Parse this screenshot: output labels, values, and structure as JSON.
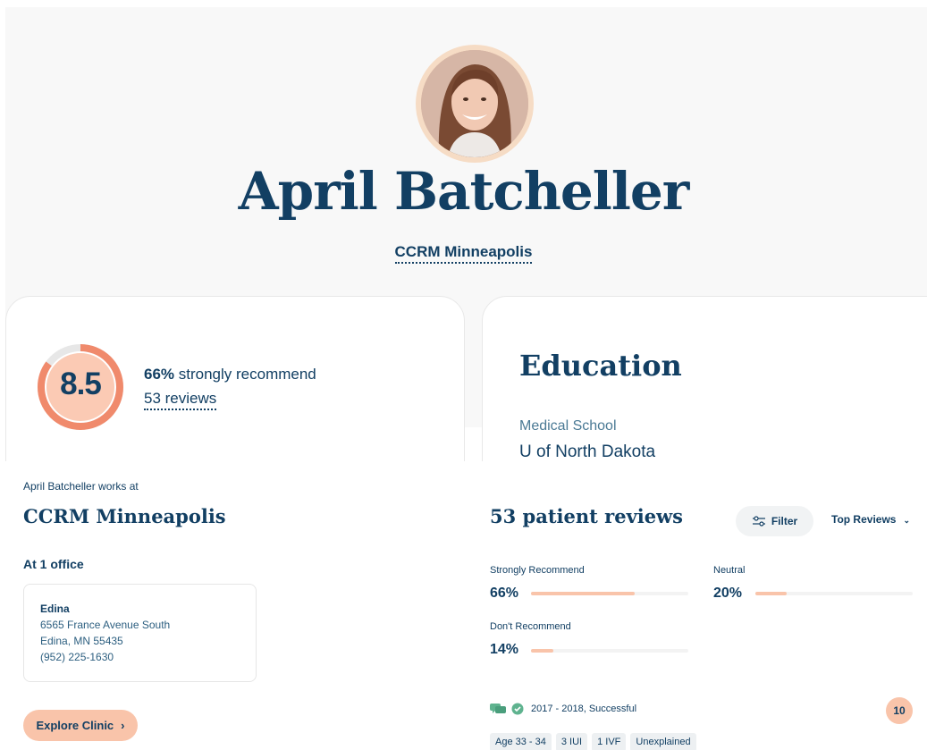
{
  "doctor": {
    "name": "April Batcheller",
    "clinic_link": "CCRM Minneapolis"
  },
  "score": {
    "value": "8.5",
    "strongly_recommend_pct": "66%",
    "strongly_recommend_text": " strongly recommend",
    "reviews_link": "53 reviews",
    "ring_color": "#f08a6c",
    "ring_fill_fraction": 0.85
  },
  "education": {
    "title": "Education",
    "label": "Medical School",
    "value": "U of North Dakota"
  },
  "works_at": {
    "intro": "April Batcheller works at",
    "clinic": "CCRM Minneapolis",
    "office_count": "At 1 office",
    "office": {
      "city": "Edina",
      "address": "6565 France Avenue South",
      "city_state": "Edina, MN 55435",
      "phone": "(952) 225-1630"
    },
    "explore_button": "Explore Clinic",
    "explore_icon": "chevron-right-icon"
  },
  "reviews": {
    "title": "53 patient reviews",
    "filter_label": "Filter",
    "filter_icon": "sliders-icon",
    "sort_label": "Top Reviews",
    "stats": [
      {
        "label": "Strongly Recommend",
        "pct": "66%",
        "fraction": 0.66
      },
      {
        "label": "Neutral",
        "pct": "20%",
        "fraction": 0.2
      },
      {
        "label": "Don't Recommend",
        "pct": "14%",
        "fraction": 0.14
      }
    ],
    "first_review": {
      "meta": "2017 - 2018, Successful",
      "count_badge": "10",
      "tags": [
        "Age 33 - 34",
        "3 IUI",
        "1 IVF",
        "Unexplained"
      ]
    }
  },
  "colors": {
    "navy": "#123f63",
    "peach": "#f9c4aa",
    "coral": "#f08a6c",
    "green": "#5fb38f"
  }
}
